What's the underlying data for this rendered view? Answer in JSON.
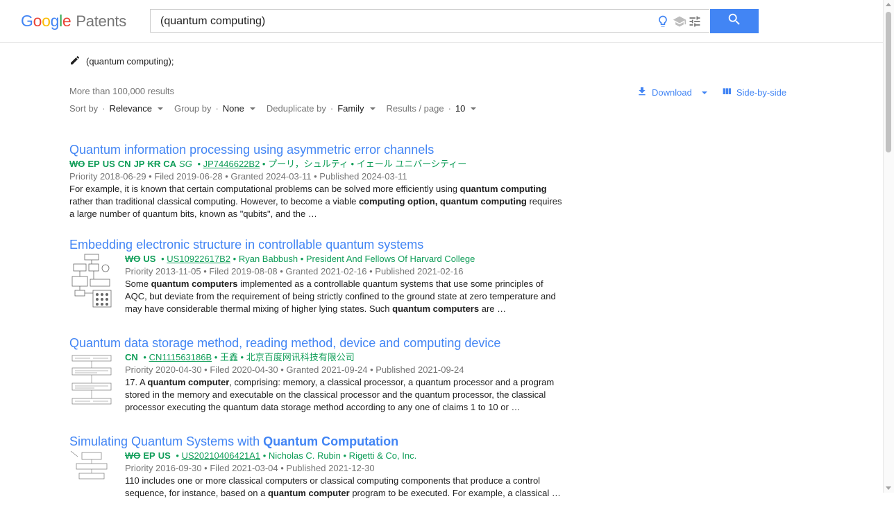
{
  "header": {
    "logo_letters": [
      "G",
      "o",
      "o",
      "g",
      "l",
      "e"
    ],
    "logo_product": "Patents",
    "search_value": "(quantum computing)",
    "icons": [
      "lightbulb-icon",
      "school-icon",
      "tune-icon",
      "search-icon"
    ]
  },
  "query": {
    "chip": "(quantum computing);"
  },
  "summary": {
    "count": "More than 100,000 results"
  },
  "sort": {
    "sort_by_label": "Sort by",
    "sort_by_value": "Relevance",
    "group_by_label": "Group by",
    "group_by_value": "None",
    "dedupe_label": "Deduplicate by",
    "dedupe_value": "Family",
    "per_page_label": "Results / page",
    "per_page_value": "10",
    "separator": "·"
  },
  "actions": {
    "download": "Download",
    "side_by_side": "Side-by-side"
  },
  "results": [
    {
      "title": "Quantum information processing using asymmetric error channels",
      "countries": [
        {
          "code": "WO",
          "style": "strike"
        },
        {
          "code": "EP",
          "style": "normal"
        },
        {
          "code": "US",
          "style": "normal"
        },
        {
          "code": "CN",
          "style": "normal"
        },
        {
          "code": "JP",
          "style": "normal"
        },
        {
          "code": "KR",
          "style": "strike"
        },
        {
          "code": "CA",
          "style": "normal"
        },
        {
          "code": "SG",
          "style": "italic"
        }
      ],
      "pub_number": "JP7446622B2",
      "assignees": "プーリ，シュルティ • イェール ユニバーシティー",
      "dates": "Priority 2018-06-29 • Filed 2019-06-28 • Granted 2024-03-11 • Published 2024-03-11",
      "snippet": [
        {
          "t": "For example, it is known that certain computational problems can be solved more efficiently using ",
          "b": false
        },
        {
          "t": "quantum computing",
          "b": true
        },
        {
          "t": " rather than traditional classical computing. However, to become a viable ",
          "b": false
        },
        {
          "t": "computing option, quantum computing",
          "b": true
        },
        {
          "t": " requires a large number of quantum bits, known as \"qubits\", and the …",
          "b": false
        }
      ]
    },
    {
      "title": "Embedding electronic structure in controllable quantum systems",
      "countries": [
        {
          "code": "WO",
          "style": "strike"
        },
        {
          "code": "US",
          "style": "normal"
        }
      ],
      "pub_number": "US10922617B2",
      "assignees": "Ryan Babbush • President And Fellows Of Harvard College",
      "dates": "Priority 2013-11-05 • Filed 2019-08-08 • Granted 2021-02-16 • Published 2021-02-16",
      "snippet": [
        {
          "t": "Some ",
          "b": false
        },
        {
          "t": "quantum computers",
          "b": true
        },
        {
          "t": " implemented as a controllable quantum systems that use some principles of AQC, but deviate from the requirement of being strictly confined to the ground state at zero temperature and may have considerable thermal mixing of higher lying states. Such ",
          "b": false
        },
        {
          "t": "quantum computers",
          "b": true
        },
        {
          "t": " are …",
          "b": false
        }
      ]
    },
    {
      "title": "Quantum data storage method, reading method, device and computing device",
      "countries": [
        {
          "code": "CN",
          "style": "normal"
        }
      ],
      "pub_number": "CN111563186B",
      "assignees": "王鑫 • 北京百度网讯科技有限公司",
      "dates": "Priority 2020-04-30 • Filed 2020-04-30 • Granted 2021-09-24 • Published 2021-09-24",
      "snippet": [
        {
          "t": "17. A ",
          "b": false
        },
        {
          "t": "quantum computer",
          "b": true
        },
        {
          "t": ", comprising: memory, a classical processor, a quantum processor and a program stored in the memory and executable on the classical processor and the quantum processor, the classical processor executing the quantum data storage method according to any one of claims 1 to 10 or …",
          "b": false
        }
      ]
    },
    {
      "title_parts": [
        {
          "t": "Simulating Quantum Systems with ",
          "b": false
        },
        {
          "t": "Quantum Computation",
          "b": true
        }
      ],
      "countries": [
        {
          "code": "WO",
          "style": "strike"
        },
        {
          "code": "EP",
          "style": "normal"
        },
        {
          "code": "US",
          "style": "normal"
        }
      ],
      "pub_number": "US20210406421A1",
      "assignees": "Nicholas C. Rubin • Rigetti & Co, Inc.",
      "dates": "Priority 2016-09-30 • Filed 2021-03-04 • Published 2021-12-30",
      "snippet": [
        {
          "t": "110 includes one or more classical computers or classical computing components that produce a control sequence, for instance, based on a ",
          "b": false
        },
        {
          "t": "quantum computer",
          "b": true
        },
        {
          "t": " program to be executed. For example, a classical …",
          "b": false
        }
      ]
    }
  ],
  "colors": {
    "accent": "#4285f4",
    "green": "#0f9d58",
    "muted": "#757575"
  }
}
